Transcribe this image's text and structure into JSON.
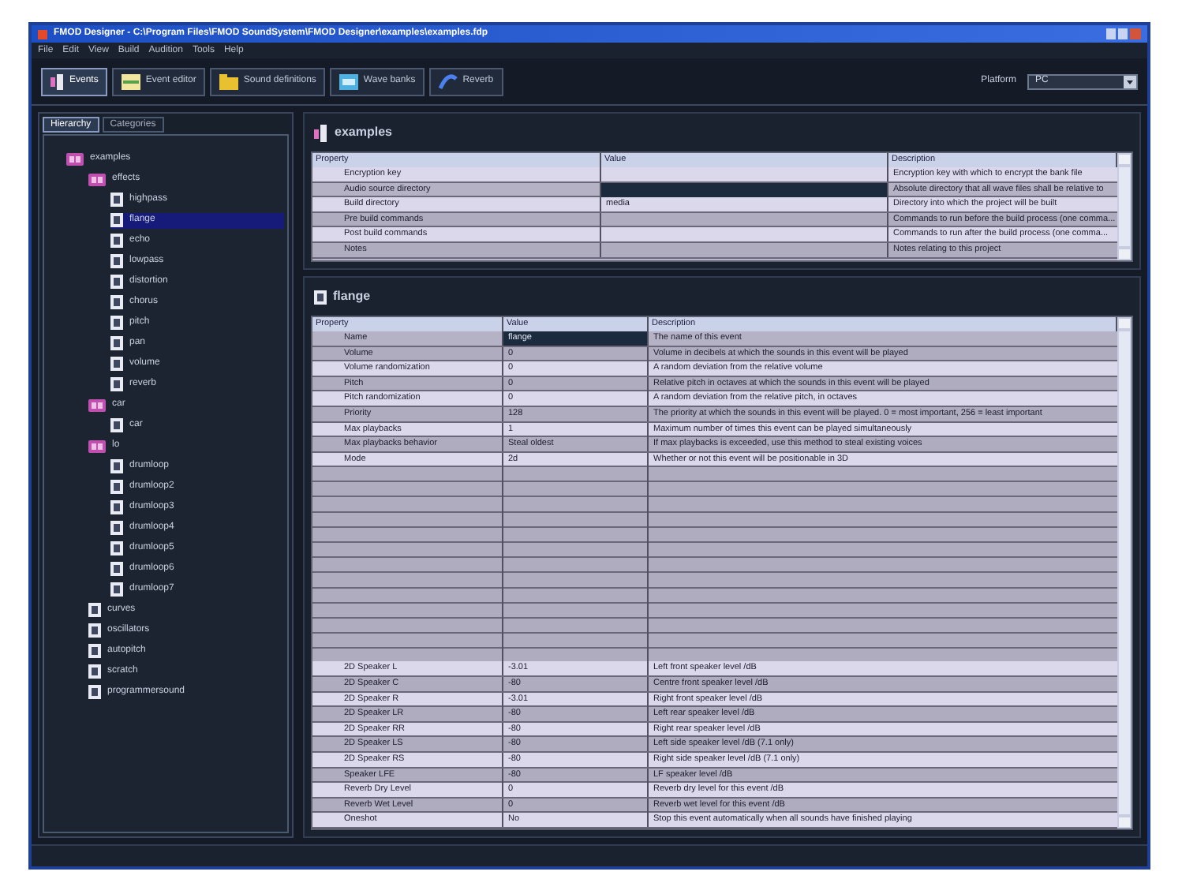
{
  "window": {
    "title": "FMOD Designer - C:\\Program Files\\FMOD SoundSystem\\FMOD Designer\\examples\\examples.fdp"
  },
  "menu": [
    "File",
    "Edit",
    "View",
    "Build",
    "Audition",
    "Tools",
    "Help"
  ],
  "tabs": [
    {
      "label": "Events",
      "selected": true
    },
    {
      "label": "Event editor",
      "selected": false
    },
    {
      "label": "Sound definitions",
      "selected": false
    },
    {
      "label": "Wave banks",
      "selected": false
    },
    {
      "label": "Reverb",
      "selected": false
    }
  ],
  "platform": {
    "label": "Platform",
    "value": "PC"
  },
  "sidebar": {
    "tabs": [
      {
        "label": "Hierarchy",
        "selected": true
      },
      {
        "label": "Categories",
        "selected": false
      }
    ],
    "tree": [
      {
        "label": "examples",
        "kind": "group",
        "selected": false,
        "children": [
          {
            "label": "effects",
            "kind": "group",
            "selected": false,
            "children": [
              {
                "label": "highpass",
                "kind": "event",
                "selected": false
              },
              {
                "label": "flange",
                "kind": "event",
                "selected": true
              },
              {
                "label": "echo",
                "kind": "event",
                "selected": false
              },
              {
                "label": "lowpass",
                "kind": "event",
                "selected": false
              },
              {
                "label": "distortion",
                "kind": "event",
                "selected": false
              },
              {
                "label": "chorus",
                "kind": "event",
                "selected": false
              },
              {
                "label": "pitch",
                "kind": "event",
                "selected": false
              },
              {
                "label": "pan",
                "kind": "event",
                "selected": false
              },
              {
                "label": "volume",
                "kind": "event",
                "selected": false
              },
              {
                "label": "reverb",
                "kind": "event",
                "selected": false
              }
            ]
          },
          {
            "label": "car",
            "kind": "group",
            "selected": false,
            "children": [
              {
                "label": "car",
                "kind": "event",
                "selected": false
              }
            ]
          },
          {
            "label": "lo",
            "kind": "group",
            "selected": false,
            "children": [
              {
                "label": "drumloop",
                "kind": "event",
                "selected": false
              },
              {
                "label": "drumloop2",
                "kind": "event",
                "selected": false
              },
              {
                "label": "drumloop3",
                "kind": "event",
                "selected": false
              },
              {
                "label": "drumloop4",
                "kind": "event",
                "selected": false
              },
              {
                "label": "drumloop5",
                "kind": "event",
                "selected": false
              },
              {
                "label": "drumloop6",
                "kind": "event",
                "selected": false
              },
              {
                "label": "drumloop7",
                "kind": "event",
                "selected": false
              }
            ]
          },
          {
            "label": "curves",
            "kind": "event",
            "selected": false
          },
          {
            "label": "oscillators",
            "kind": "event",
            "selected": false
          },
          {
            "label": "autopitch",
            "kind": "event",
            "selected": false
          },
          {
            "label": "scratch",
            "kind": "event",
            "selected": false
          },
          {
            "label": "programmersound",
            "kind": "event",
            "selected": false
          }
        ]
      }
    ]
  },
  "project_panel": {
    "title": "examples",
    "columns": [
      "Property",
      "Value",
      "Description"
    ],
    "rows": [
      {
        "property": "Encryption key",
        "value": "",
        "description": "Encryption key with which to encrypt the bank file",
        "selected": false
      },
      {
        "property": "Audio source directory",
        "value": "",
        "description": "Absolute directory that all wave files shall be relative to",
        "selected": true
      },
      {
        "property": "Build directory",
        "value": "media",
        "description": "Directory into which the project will be built",
        "selected": false
      },
      {
        "property": "Pre build commands",
        "value": "",
        "description": "Commands to run before the build process (one comma...",
        "selected": false
      },
      {
        "property": "Post build commands",
        "value": "",
        "description": "Commands to run after the build process (one comma...",
        "selected": false
      },
      {
        "property": "Notes",
        "value": "",
        "description": "Notes relating to this project",
        "selected": false
      }
    ]
  },
  "event_panel": {
    "title": "flange",
    "columns": [
      "Property",
      "Value",
      "Description"
    ],
    "rows": [
      {
        "property": "Name",
        "value": "flange",
        "description": "The name of this event",
        "selected": true
      },
      {
        "property": "Volume",
        "value": "0",
        "description": "Volume in decibels at which the sounds in this event will be played",
        "selected": false
      },
      {
        "property": "Volume randomization",
        "value": "0",
        "description": "A random deviation from the relative volume",
        "selected": false
      },
      {
        "property": "Pitch",
        "value": "0",
        "description": "Relative pitch in octaves at which the sounds in this event will be played",
        "selected": false
      },
      {
        "property": "Pitch randomization",
        "value": "0",
        "description": "A random deviation from the relative pitch, in octaves",
        "selected": false
      },
      {
        "property": "Priority",
        "value": "128",
        "description": "The priority at which the sounds in this event will be played. 0 = most important, 256 = least important",
        "selected": false
      },
      {
        "property": "Max playbacks",
        "value": "1",
        "description": "Maximum number of times this event can be played simultaneously",
        "selected": false
      },
      {
        "property": "Max playbacks behavior",
        "value": "Steal oldest",
        "description": "If max playbacks is exceeded, use this method to steal existing voices",
        "selected": false
      },
      {
        "property": "Mode",
        "value": "2d",
        "description": "Whether or not this event will be positionable in 3D",
        "selected": false
      }
    ],
    "rows_after_gap": [
      {
        "property": "2D Speaker L",
        "value": "-3.01",
        "description": "Left front speaker level /dB",
        "selected": false
      },
      {
        "property": "2D Speaker C",
        "value": "-80",
        "description": "Centre front speaker level /dB",
        "selected": false
      },
      {
        "property": "2D Speaker R",
        "value": "-3.01",
        "description": "Right front speaker level /dB",
        "selected": false
      },
      {
        "property": "2D Speaker LR",
        "value": "-80",
        "description": "Left rear speaker level /dB",
        "selected": false
      },
      {
        "property": "2D Speaker RR",
        "value": "-80",
        "description": "Right rear speaker level /dB",
        "selected": false
      },
      {
        "property": "2D Speaker LS",
        "value": "-80",
        "description": "Left side speaker level /dB (7.1 only)",
        "selected": false
      },
      {
        "property": "2D Speaker RS",
        "value": "-80",
        "description": "Right side speaker level /dB (7.1 only)",
        "selected": false
      },
      {
        "property": "Speaker LFE",
        "value": "-80",
        "description": "LF speaker level /dB",
        "selected": false
      },
      {
        "property": "Reverb Dry Level",
        "value": "0",
        "description": "Reverb dry level for this event /dB",
        "selected": false
      },
      {
        "property": "Reverb Wet Level",
        "value": "0",
        "description": "Reverb wet level for this event /dB",
        "selected": false
      },
      {
        "property": "Oneshot",
        "value": "No",
        "description": "Stop this event automatically when all sounds have finished playing",
        "selected": false
      }
    ]
  }
}
